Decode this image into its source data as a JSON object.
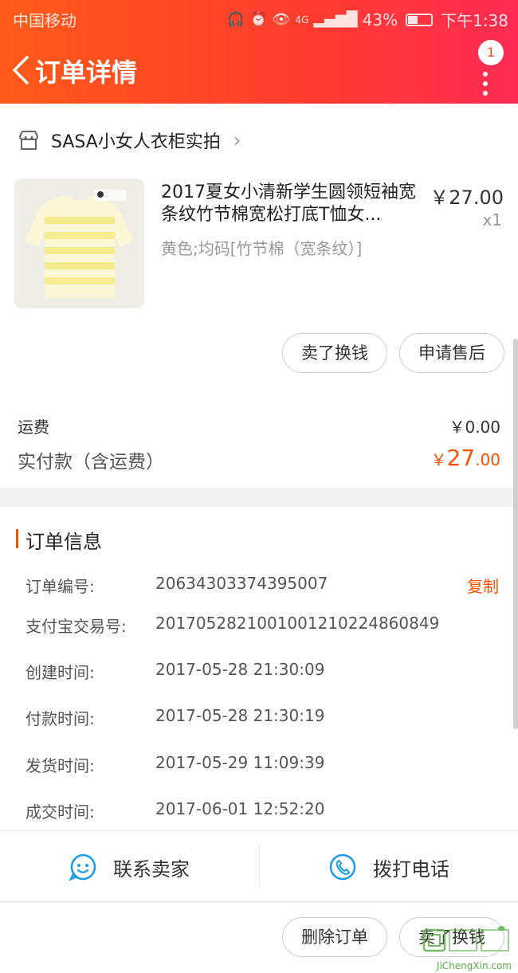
{
  "status_bar": {
    "carrier": "中国移动",
    "battery": "43%",
    "time": "下午1:38",
    "network": "4G"
  },
  "nav": {
    "title": "订单详情",
    "badge_count": "1"
  },
  "shop": {
    "name": "SASA小女人衣柜实拍"
  },
  "product": {
    "title": "2017夏女小清新学生圆领短袖宽条纹竹节棉宽松打底T恤女...",
    "sku": "黄色;均码[竹节棉（宽条纹）]",
    "price": "￥27.00",
    "quantity": "x1"
  },
  "item_actions": {
    "resell_label": "卖了换钱",
    "after_sale_label": "申请售后"
  },
  "payment": {
    "shipping_label": "运费",
    "shipping_value": "￥0.00",
    "paid_label": "实付款（含运费）",
    "paid_currency": "￥",
    "paid_int": "27",
    "paid_dec": ".00"
  },
  "order_info": {
    "title": "订单信息",
    "copy_label": "复制",
    "rows": [
      {
        "label": "订单编号:",
        "value": "20634303374395007"
      },
      {
        "label": "支付宝交易号:",
        "value": "2017052821001001210224860849"
      },
      {
        "label": "创建时间:",
        "value": "2017-05-28 21:30:09"
      },
      {
        "label": "付款时间:",
        "value": "2017-05-28 21:30:19"
      },
      {
        "label": "发货时间:",
        "value": "2017-05-29 11:09:39"
      },
      {
        "label": "成交时间:",
        "value": "2017-06-01 12:52:20"
      }
    ]
  },
  "contact": {
    "seller_label": "联系卖家",
    "phone_label": "拨打电话"
  },
  "bottom_actions": {
    "delete_label": "删除订单",
    "resell_label": "卖了换钱"
  },
  "watermark": {
    "text": "JiChengXin.com"
  },
  "colors": {
    "accent": "#ff5000",
    "header_start": "#ff5a1a",
    "header_end": "#ff2b55",
    "contact_icon": "#1e9be8"
  }
}
